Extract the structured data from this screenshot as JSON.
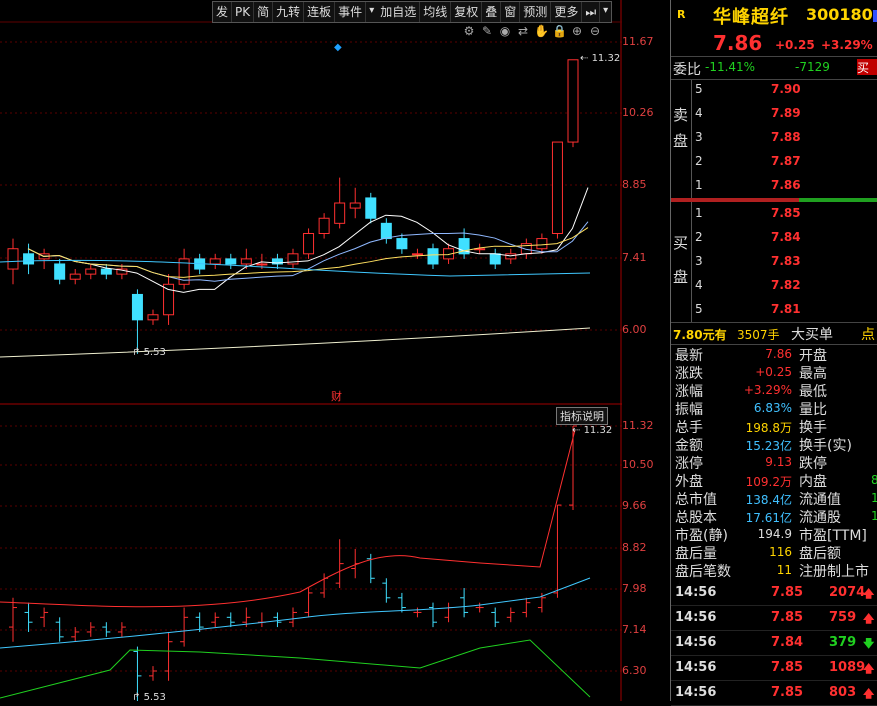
{
  "toolbar": {
    "items": [
      "发",
      "PK",
      "简",
      "九转",
      "连板",
      "事件",
      "▾",
      "加自选",
      "均线",
      "复权",
      "叠",
      "窗",
      "预测",
      "更多",
      "⏭",
      "▾"
    ]
  },
  "tool_icons": [
    "settings-icon",
    "pencil-icon",
    "eye-icon",
    "arrows-icon",
    "hand-icon",
    "lock-icon",
    "zoom-in-icon",
    "zoom-out-icon"
  ],
  "tool_glyphs": [
    "⚙",
    "✎",
    "◉",
    "⇄",
    "✋",
    "🔒",
    "⊕",
    "⊖"
  ],
  "main_axis": [
    "11.67",
    "10.26",
    "8.85",
    "7.41",
    "6.00"
  ],
  "sub_axis": [
    "11.32",
    "10.50",
    "9.66",
    "8.82",
    "7.98",
    "7.14",
    "6.30"
  ],
  "main_high_label": "11.32",
  "main_low_label": "5.53",
  "sub_high_label": "11.32",
  "sub_low_label": "5.53",
  "cai_label": "财",
  "indicator_btn": "指标说明",
  "stock": {
    "flag": "R",
    "name": "华峰超纤",
    "code": "300180",
    "price": "7.86",
    "change": "+0.25",
    "pct": "+3.29%"
  },
  "weibi": {
    "label": "委比",
    "pct": "-11.41%",
    "diff": "-7129",
    "btn": "买"
  },
  "ask_label": [
    "卖",
    "盘"
  ],
  "bid_label": [
    "买",
    "盘"
  ],
  "asks": [
    {
      "lvl": "5",
      "price": "7.90"
    },
    {
      "lvl": "4",
      "price": "7.89"
    },
    {
      "lvl": "3",
      "price": "7.88"
    },
    {
      "lvl": "2",
      "price": "7.87"
    },
    {
      "lvl": "1",
      "price": "7.86"
    }
  ],
  "bids": [
    {
      "lvl": "1",
      "price": "7.85"
    },
    {
      "lvl": "2",
      "price": "7.84"
    },
    {
      "lvl": "3",
      "price": "7.83"
    },
    {
      "lvl": "4",
      "price": "7.82"
    },
    {
      "lvl": "5",
      "price": "7.81"
    }
  ],
  "trade_line": {
    "price": "7.80元有",
    "vol": "3507手",
    "label": "大买单",
    "more": "点"
  },
  "stats": [
    {
      "k": "最新",
      "v": "7.86",
      "vc": "#ff3030",
      "k2": "开盘",
      "v2": ""
    },
    {
      "k": "涨跌",
      "v": "+0.25",
      "vc": "#ff3030",
      "k2": "最高",
      "v2": ""
    },
    {
      "k": "涨幅",
      "v": "+3.29%",
      "vc": "#ff3030",
      "k2": "最低",
      "v2": ""
    },
    {
      "k": "振幅",
      "v": "6.83%",
      "vc": "#40c0ff",
      "k2": "量比",
      "v2": ""
    },
    {
      "k": "总手",
      "v": "198.8万",
      "vc": "#ffd400",
      "k2": "换手",
      "v2": ""
    },
    {
      "k": "金额",
      "v": "15.23亿",
      "vc": "#40c0ff",
      "k2": "换手(实)",
      "v2": ""
    },
    {
      "k": "涨停",
      "v": "9.13",
      "vc": "#ff3030",
      "k2": "跌停",
      "v2": ""
    },
    {
      "k": "外盘",
      "v": "109.2万",
      "vc": "#ff3030",
      "k2": "内盘",
      "v2": "8"
    },
    {
      "k": "总市值",
      "v": "138.4亿",
      "vc": "#40c0ff",
      "k2": "流通值",
      "v2": "1"
    },
    {
      "k": "总股本",
      "v": "17.61亿",
      "vc": "#40c0ff",
      "k2": "流通股",
      "v2": "1"
    },
    {
      "k": "市盈(静)",
      "v": "194.9",
      "vc": "#ddd",
      "k2": "市盈[TTM]",
      "v2": ""
    },
    {
      "k": "盘后量",
      "v": "116",
      "vc": "#ffd400",
      "k2": "盘后额",
      "v2": ""
    },
    {
      "k": "盘后笔数",
      "v": "11",
      "vc": "#ffd400",
      "k2": "注册制上市",
      "v2": ""
    }
  ],
  "ticks": [
    {
      "time": "14:56",
      "price": "7.85",
      "vol": "2074",
      "dir": "up"
    },
    {
      "time": "14:56",
      "price": "7.85",
      "vol": "759",
      "dir": "up"
    },
    {
      "time": "14:56",
      "price": "7.84",
      "vol": "379",
      "dir": "down"
    },
    {
      "time": "14:56",
      "price": "7.85",
      "vol": "1089",
      "dir": "up"
    },
    {
      "time": "14:56",
      "price": "7.85",
      "vol": "803",
      "dir": "up"
    }
  ],
  "chart_data": {
    "type": "candlestick",
    "candles": [
      [
        7.2,
        7.6,
        6.9,
        7.8
      ],
      [
        7.5,
        7.3,
        7.1,
        7.7
      ],
      [
        7.4,
        7.5,
        7.2,
        7.6
      ],
      [
        7.3,
        7.0,
        6.9,
        7.4
      ],
      [
        7.0,
        7.1,
        6.9,
        7.2
      ],
      [
        7.1,
        7.2,
        7.0,
        7.3
      ],
      [
        7.2,
        7.1,
        7.0,
        7.3
      ],
      [
        7.1,
        7.2,
        7.0,
        7.3
      ],
      [
        6.7,
        6.2,
        5.53,
        6.8
      ],
      [
        6.2,
        6.3,
        6.1,
        6.4
      ],
      [
        6.3,
        6.9,
        6.1,
        7.1
      ],
      [
        6.9,
        7.4,
        6.8,
        7.6
      ],
      [
        7.4,
        7.2,
        7.1,
        7.5
      ],
      [
        7.3,
        7.4,
        7.2,
        7.5
      ],
      [
        7.4,
        7.3,
        7.2,
        7.5
      ],
      [
        7.3,
        7.4,
        7.2,
        7.6
      ],
      [
        7.3,
        7.3,
        7.2,
        7.5
      ],
      [
        7.4,
        7.3,
        7.2,
        7.5
      ],
      [
        7.3,
        7.5,
        7.2,
        7.6
      ],
      [
        7.5,
        7.9,
        7.4,
        8.0
      ],
      [
        7.9,
        8.2,
        7.8,
        8.3
      ],
      [
        8.1,
        8.5,
        8.0,
        9.0
      ],
      [
        8.4,
        8.5,
        8.2,
        8.8
      ],
      [
        8.6,
        8.2,
        8.1,
        8.7
      ],
      [
        8.1,
        7.8,
        7.7,
        8.2
      ],
      [
        7.8,
        7.6,
        7.5,
        7.9
      ],
      [
        7.5,
        7.5,
        7.4,
        7.6
      ],
      [
        7.6,
        7.3,
        7.2,
        7.7
      ],
      [
        7.4,
        7.6,
        7.3,
        7.7
      ],
      [
        7.8,
        7.5,
        7.4,
        8.0
      ],
      [
        7.6,
        7.6,
        7.5,
        7.7
      ],
      [
        7.5,
        7.3,
        7.2,
        7.6
      ],
      [
        7.4,
        7.5,
        7.3,
        7.6
      ],
      [
        7.5,
        7.7,
        7.4,
        7.8
      ],
      [
        7.6,
        7.8,
        7.5,
        7.9
      ],
      [
        7.9,
        9.7,
        7.8,
        9.7
      ],
      [
        9.7,
        11.32,
        9.6,
        11.32
      ]
    ],
    "ylim_main": [
      5.4,
      11.9
    ]
  }
}
